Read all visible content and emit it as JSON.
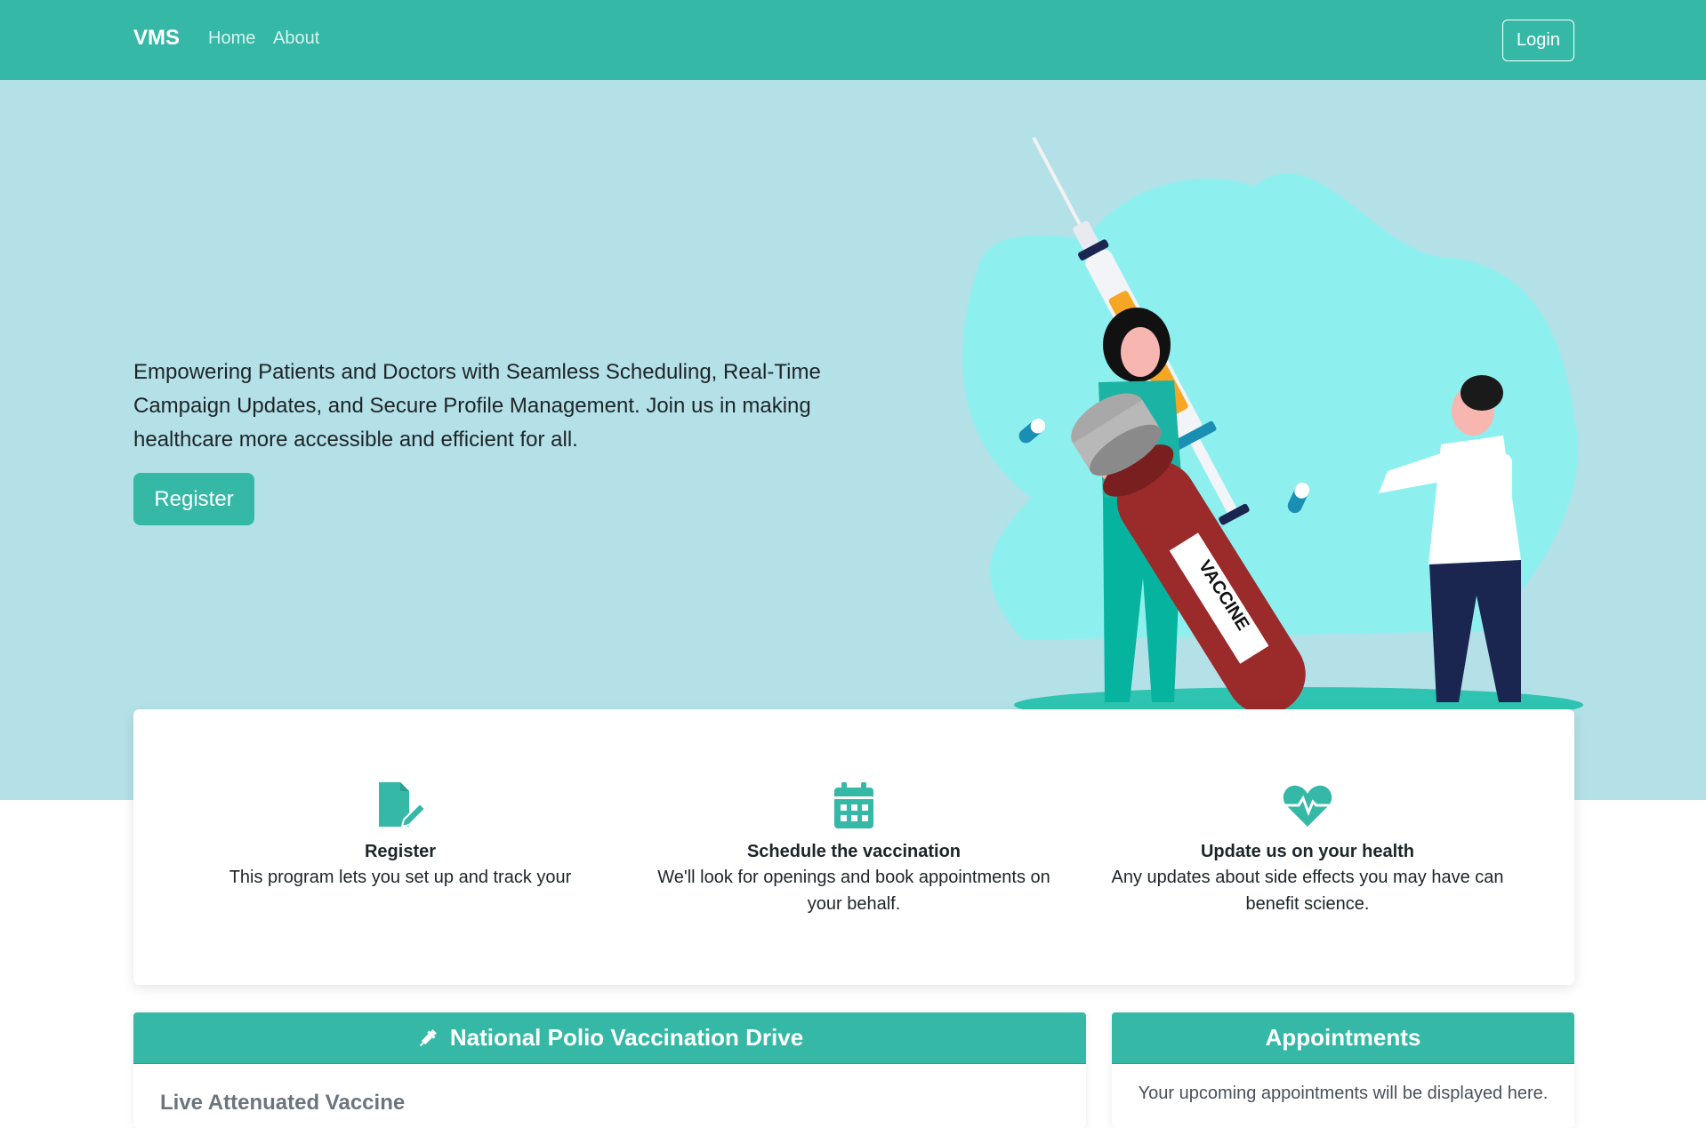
{
  "navbar": {
    "brand": "VMS",
    "links": [
      "Home",
      "About"
    ],
    "login_label": "Login"
  },
  "hero": {
    "text": "Empowering Patients and Doctors with Seamless Scheduling, Real-Time Campaign Updates, and Secure Profile Management. Join us in making healthcare more accessible and efficient for all.",
    "register_label": "Register",
    "illustration_label": "VACCINE"
  },
  "features": [
    {
      "icon": "file-signature-icon",
      "title": "Register",
      "description": "This program lets you set up and track your"
    },
    {
      "icon": "calendar-icon",
      "title": "Schedule the vaccination",
      "description": "We'll look for openings and book appointments on your behalf."
    },
    {
      "icon": "heart-pulse-icon",
      "title": "Update us on your health",
      "description": "Any updates about side effects you may have can benefit science."
    }
  ],
  "drive_card": {
    "icon": "syringe-icon",
    "title": "National Polio Vaccination Drive",
    "subtitle": "Live Attenuated Vaccine"
  },
  "appointments_card": {
    "title": "Appointments",
    "body": "Your upcoming appointments will be displayed here."
  },
  "colors": {
    "primary": "#36b8a7",
    "hero_bg": "#b4e0e7",
    "text": "#1d2528"
  }
}
